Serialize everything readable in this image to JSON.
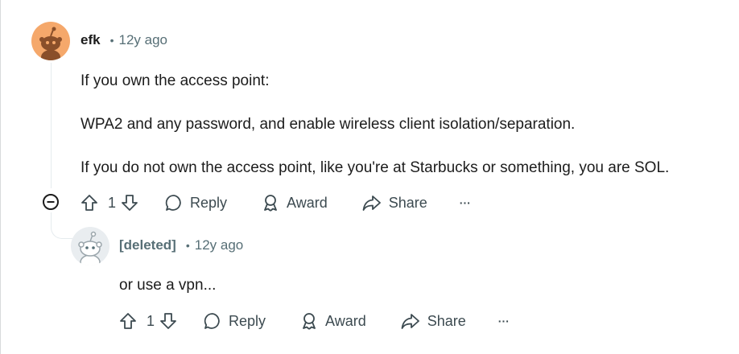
{
  "comments": [
    {
      "author": "efk",
      "separator": "•",
      "time": "12y ago",
      "paragraphs": [
        "If you own the access point:",
        "WPA2 and any password, and enable wireless client isolation/separation.",
        "If you do not own the access point, like you're at Starbucks or something, you are SOL."
      ],
      "votes": "1",
      "reply_label": "Reply",
      "award_label": "Award",
      "share_label": "Share",
      "more_label": "···"
    },
    {
      "author": "[deleted]",
      "separator": "•",
      "time": "12y ago",
      "paragraphs": [
        "or use a vpn..."
      ],
      "votes": "1",
      "reply_label": "Reply",
      "award_label": "Award",
      "share_label": "Share",
      "more_label": "···"
    }
  ],
  "icons": {
    "avatar_1": "snoo-avatar-orange",
    "avatar_2": "snoo-avatar-deleted",
    "collapse": "minus-circle-icon",
    "upvote": "arrow-up-icon",
    "downvote": "arrow-down-icon",
    "reply": "speech-bubble-icon",
    "award": "award-ribbon-icon",
    "share": "share-arrow-icon"
  },
  "colors": {
    "avatar_orange": "#f5a86b",
    "meta_gray": "#576f76",
    "action_gray": "#3c4a50",
    "thread_line": "#e5ebee"
  }
}
